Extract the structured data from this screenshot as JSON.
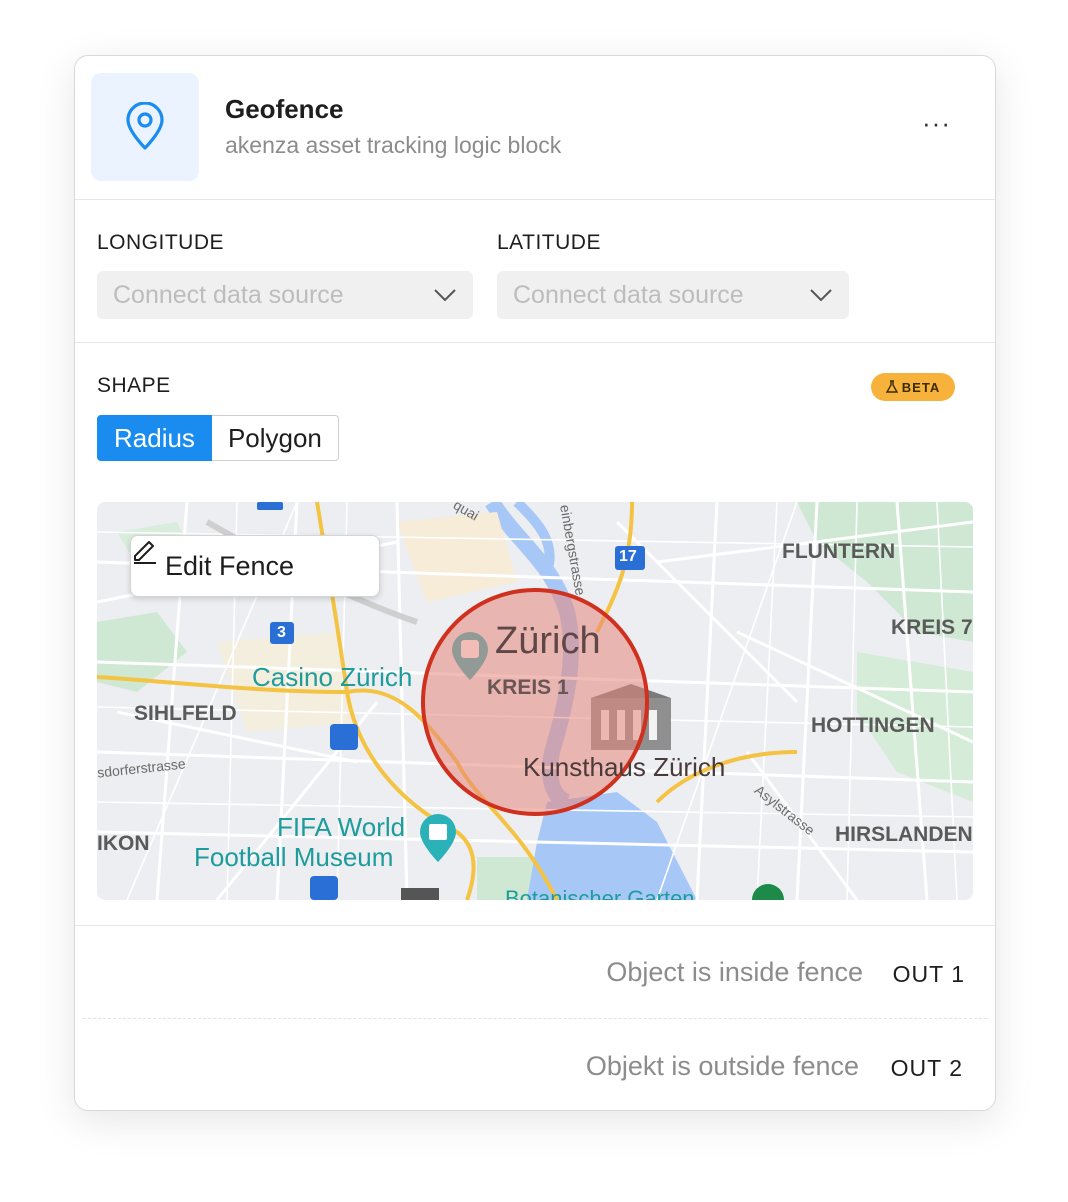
{
  "header": {
    "title": "Geofence",
    "subtitle": "akenza asset tracking logic block",
    "more_label": "···",
    "icon": "location-pin-icon"
  },
  "inputs": {
    "longitude": {
      "label": "LONGITUDE",
      "placeholder": "Connect data source"
    },
    "latitude": {
      "label": "LATITUDE",
      "placeholder": "Connect data source"
    }
  },
  "shape": {
    "label": "SHAPE",
    "badge": "BETA",
    "options": [
      "Radius",
      "Polygon"
    ],
    "selected": "Radius"
  },
  "map": {
    "edit_button": "Edit Fence",
    "labels": {
      "zurich": "Zürich",
      "kreis1": "KREIS 1",
      "kunsthaus": "Kunsthaus Zürich",
      "casino": "Casino Zürich",
      "sihlfeld": "SIHLFELD",
      "fluntern": "FLUNTERN",
      "kreis7": "KREIS 7",
      "hottingen": "HOTTINGEN",
      "hirslanden": "HIRSLANDEN",
      "fifa1": "FIFA World",
      "fifa2": "Football Museum",
      "ikon": "IKON",
      "asylstrasse": "Asylstrasse",
      "einbergstrasse": "einbergstrasse",
      "badener": "sdorferstrasse",
      "botanischer": "Botanischer Garten",
      "route17": "17",
      "route3": "3",
      "quai": "quai"
    }
  },
  "outputs": [
    {
      "label": "Object is inside fence",
      "port": "OUT 1"
    },
    {
      "label": "Objekt is outside fence",
      "port": "OUT 2"
    }
  ],
  "colors": {
    "accent": "#1a8cf0",
    "beta": "#f7b23b",
    "fence_stroke": "#d0301e",
    "fence_fill": "#e8877b"
  }
}
